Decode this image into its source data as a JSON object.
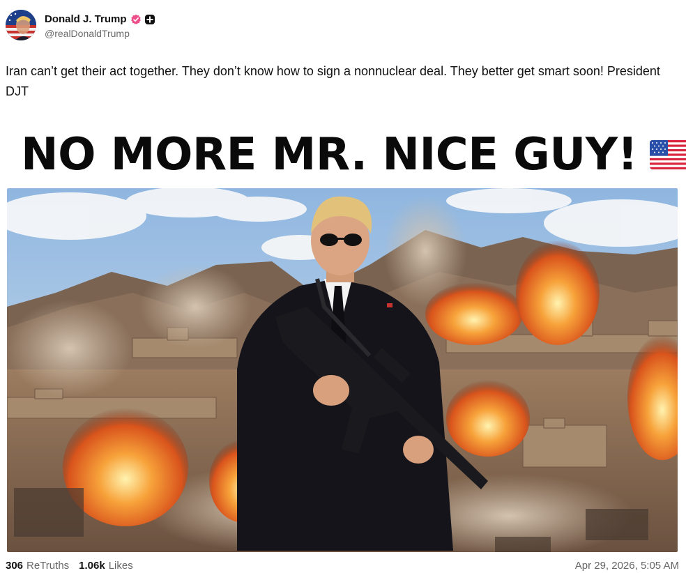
{
  "author": {
    "display_name": "Donald J. Trump",
    "handle": "@realDonaldTrump",
    "avatar_icon": "american-flag-portrait-avatar",
    "verified_icon": "verified-badge-icon",
    "verified_color": "#ec4e8a",
    "extra_icon": "plus-badge-icon"
  },
  "post": {
    "text": "Iran can’t get their act together. They don’t know how to sign a nonnuclear deal. They better get smart soon! President DJT",
    "image_headline": "NO MORE MR. NICE GUY!",
    "image_headline_icon": "us-flag-icon",
    "image_description_icon": "man-in-suit-with-rifle-explosions-image"
  },
  "stats": {
    "retruths_count": "306",
    "retruths_label": "ReTruths",
    "likes_count": "1.06k",
    "likes_label": "Likes",
    "timestamp": "Apr 29, 2026, 5:05 AM"
  },
  "colors": {
    "text": "#111111",
    "muted": "#666666",
    "headline": "#0a0a0a"
  }
}
